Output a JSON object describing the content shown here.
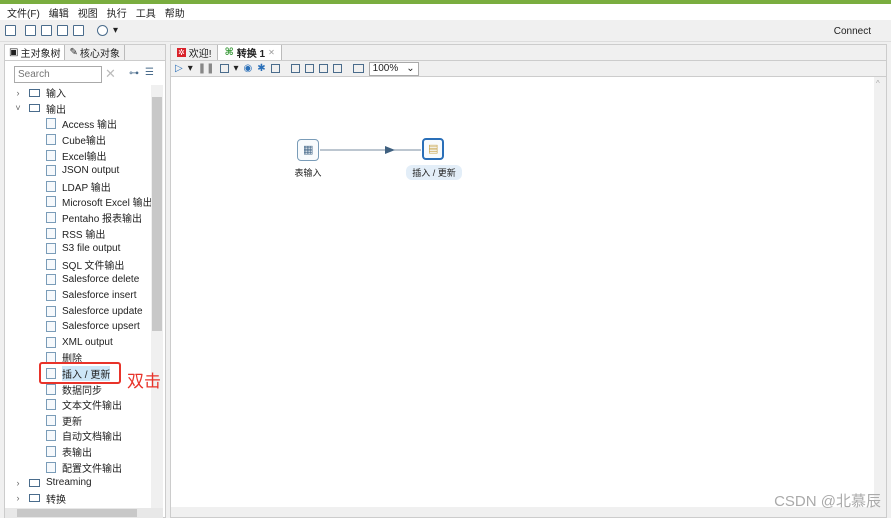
{
  "menu": [
    "文件(F)",
    "编辑",
    "视图",
    "执行",
    "工具",
    "帮助"
  ],
  "connect": "Connect",
  "left": {
    "tabs": [
      "主对象树",
      "核心对象"
    ],
    "search_placeholder": "Search",
    "folders_top": [
      "输入",
      "输出"
    ],
    "items": [
      "Access 输出",
      "Cube输出",
      "Excel输出",
      "JSON output",
      "LDAP 输出",
      "Microsoft Excel 输出",
      "Pentaho 报表输出",
      "RSS 输出",
      "S3 file output",
      "SQL 文件输出",
      "Salesforce delete",
      "Salesforce insert",
      "Salesforce update",
      "Salesforce upsert",
      "XML output",
      "删除",
      "插入 / 更新",
      "数据同步",
      "文本文件输出",
      "更新",
      "自动文档输出",
      "表输出",
      "配置文件输出"
    ],
    "folders_bottom": [
      "Streaming",
      "转换"
    ],
    "selected": "插入 / 更新"
  },
  "annotation": "双击",
  "right": {
    "tabs": [
      "欢迎!",
      "转换 1"
    ],
    "zoom": "100%",
    "steps": [
      {
        "label": "表输入"
      },
      {
        "label": "插入 / 更新"
      }
    ]
  },
  "watermark": "CSDN @北慕辰",
  "colors": {
    "accent": "#7aad3f",
    "highlight": "#e8332a",
    "selection": "#2a6fb8"
  }
}
